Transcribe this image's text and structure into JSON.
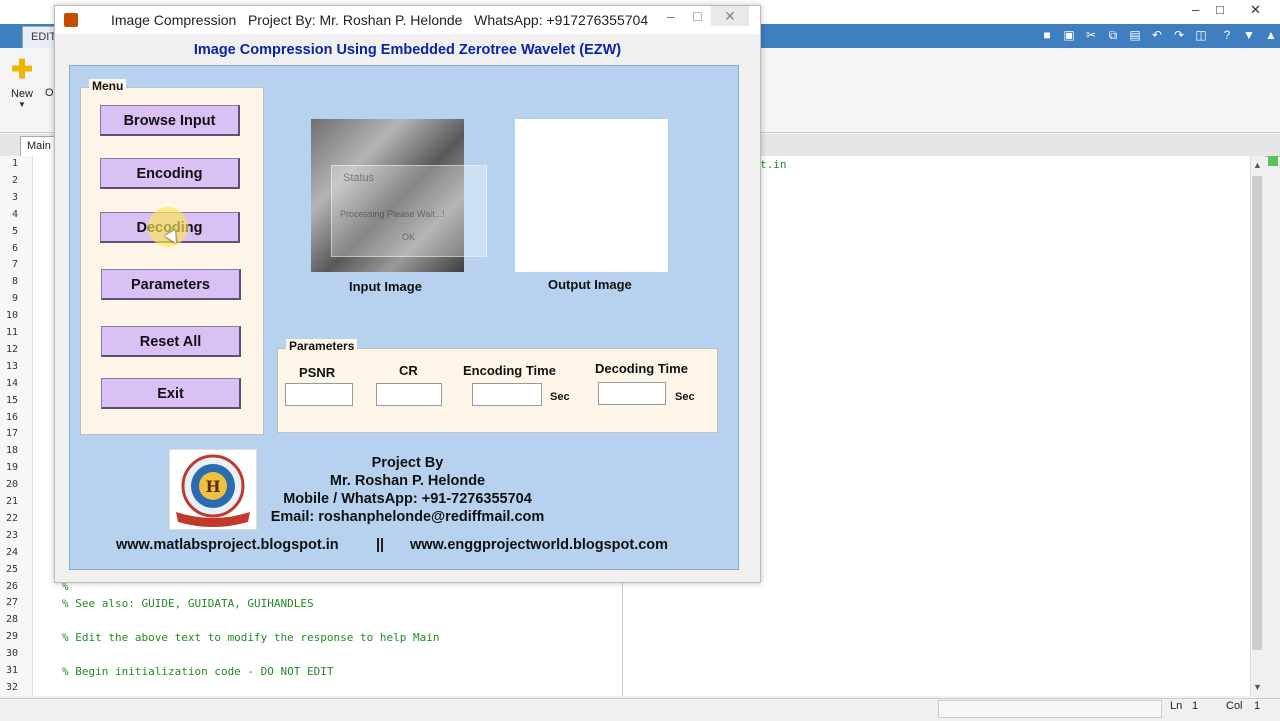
{
  "background": {
    "editor_tab": "EDITO",
    "toolstrip_new": "New",
    "toolstrip_clipped": "O",
    "doc_tab": "Main",
    "code_fragment_right": "t.in",
    "line_numbers": [
      "1",
      "2",
      "3",
      "4",
      "5",
      "6",
      "7",
      "8",
      "9",
      "10",
      "11",
      "12",
      "13",
      "14",
      "15",
      "16",
      "17",
      "18",
      "19",
      "20",
      "21",
      "22",
      "23",
      "24",
      "25",
      "26",
      "27",
      "28",
      "29",
      "30",
      "31",
      "32"
    ],
    "code_lines": [
      {
        "line": "26",
        "text": "%"
      },
      {
        "line": "27",
        "text": "% See also: GUIDE, GUIDATA, GUIHANDLES"
      },
      {
        "line": "29",
        "text": "% Edit the above text to modify the response to help Main"
      },
      {
        "line": "31",
        "text": "% Begin initialization code - DO NOT EDIT"
      }
    ],
    "status": {
      "ln_label": "Ln",
      "ln_value": "1",
      "col_label": "Col",
      "col_value": "1"
    }
  },
  "window": {
    "title": "Image Compression   Project By: Mr. Roshan P. Helonde   WhatsApp: +917276355704",
    "heading": "Image Compression Using Embedded Zerotree Wavelet (EZW)"
  },
  "menu": {
    "title": "Menu",
    "buttons": [
      "Browse Input",
      "Encoding",
      "Decoding",
      "Parameters",
      "Reset All",
      "Exit"
    ]
  },
  "images": {
    "input_label": "Input Image",
    "output_label": "Output Image",
    "overlay_title": "Status",
    "overlay_text": "Processing Please Wait...!",
    "overlay_ok": "OK"
  },
  "parameters": {
    "title": "Parameters",
    "psnr": "PSNR",
    "cr": "CR",
    "encoding_time": "Encoding Time",
    "decoding_time": "Decoding Time",
    "unit": "Sec",
    "psnr_value": "",
    "cr_value": "",
    "encoding_value": "",
    "decoding_value": ""
  },
  "credits": {
    "project_by": "Project By",
    "name": "Mr. Roshan P. Helonde",
    "mobile": "Mobile / WhatsApp: +91-7276355704",
    "email": "Email: roshanphelonde@rediffmail.com",
    "url1": "www.matlabsproject.blogspot.in",
    "separator": "||",
    "url2": "www.enggprojectworld.blogspot.com"
  }
}
